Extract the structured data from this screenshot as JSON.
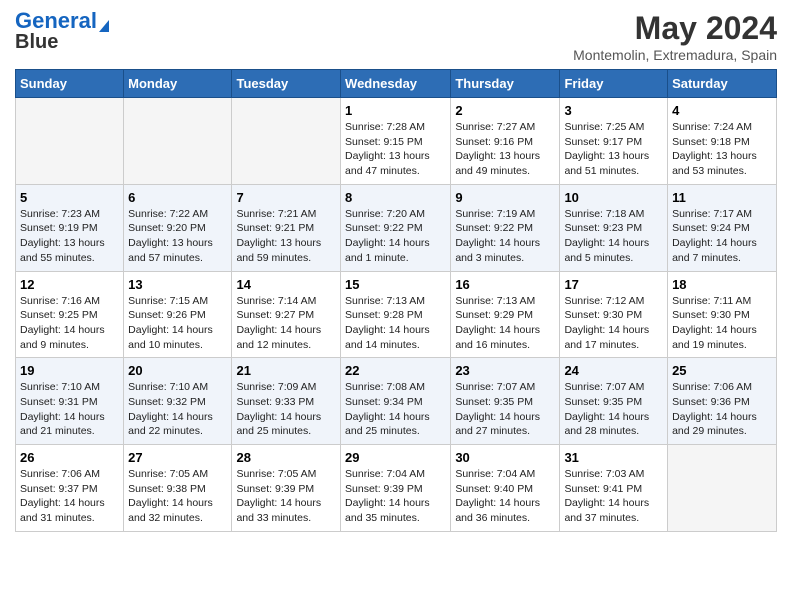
{
  "logo": {
    "part1": "General",
    "part2": "Blue"
  },
  "title": "May 2024",
  "subtitle": "Montemolin, Extremadura, Spain",
  "days_of_week": [
    "Sunday",
    "Monday",
    "Tuesday",
    "Wednesday",
    "Thursday",
    "Friday",
    "Saturday"
  ],
  "weeks": [
    [
      {
        "num": "",
        "sunrise": "",
        "sunset": "",
        "daylight": ""
      },
      {
        "num": "",
        "sunrise": "",
        "sunset": "",
        "daylight": ""
      },
      {
        "num": "",
        "sunrise": "",
        "sunset": "",
        "daylight": ""
      },
      {
        "num": "1",
        "sunrise": "Sunrise: 7:28 AM",
        "sunset": "Sunset: 9:15 PM",
        "daylight": "Daylight: 13 hours and 47 minutes."
      },
      {
        "num": "2",
        "sunrise": "Sunrise: 7:27 AM",
        "sunset": "Sunset: 9:16 PM",
        "daylight": "Daylight: 13 hours and 49 minutes."
      },
      {
        "num": "3",
        "sunrise": "Sunrise: 7:25 AM",
        "sunset": "Sunset: 9:17 PM",
        "daylight": "Daylight: 13 hours and 51 minutes."
      },
      {
        "num": "4",
        "sunrise": "Sunrise: 7:24 AM",
        "sunset": "Sunset: 9:18 PM",
        "daylight": "Daylight: 13 hours and 53 minutes."
      }
    ],
    [
      {
        "num": "5",
        "sunrise": "Sunrise: 7:23 AM",
        "sunset": "Sunset: 9:19 PM",
        "daylight": "Daylight: 13 hours and 55 minutes."
      },
      {
        "num": "6",
        "sunrise": "Sunrise: 7:22 AM",
        "sunset": "Sunset: 9:20 PM",
        "daylight": "Daylight: 13 hours and 57 minutes."
      },
      {
        "num": "7",
        "sunrise": "Sunrise: 7:21 AM",
        "sunset": "Sunset: 9:21 PM",
        "daylight": "Daylight: 13 hours and 59 minutes."
      },
      {
        "num": "8",
        "sunrise": "Sunrise: 7:20 AM",
        "sunset": "Sunset: 9:22 PM",
        "daylight": "Daylight: 14 hours and 1 minute."
      },
      {
        "num": "9",
        "sunrise": "Sunrise: 7:19 AM",
        "sunset": "Sunset: 9:22 PM",
        "daylight": "Daylight: 14 hours and 3 minutes."
      },
      {
        "num": "10",
        "sunrise": "Sunrise: 7:18 AM",
        "sunset": "Sunset: 9:23 PM",
        "daylight": "Daylight: 14 hours and 5 minutes."
      },
      {
        "num": "11",
        "sunrise": "Sunrise: 7:17 AM",
        "sunset": "Sunset: 9:24 PM",
        "daylight": "Daylight: 14 hours and 7 minutes."
      }
    ],
    [
      {
        "num": "12",
        "sunrise": "Sunrise: 7:16 AM",
        "sunset": "Sunset: 9:25 PM",
        "daylight": "Daylight: 14 hours and 9 minutes."
      },
      {
        "num": "13",
        "sunrise": "Sunrise: 7:15 AM",
        "sunset": "Sunset: 9:26 PM",
        "daylight": "Daylight: 14 hours and 10 minutes."
      },
      {
        "num": "14",
        "sunrise": "Sunrise: 7:14 AM",
        "sunset": "Sunset: 9:27 PM",
        "daylight": "Daylight: 14 hours and 12 minutes."
      },
      {
        "num": "15",
        "sunrise": "Sunrise: 7:13 AM",
        "sunset": "Sunset: 9:28 PM",
        "daylight": "Daylight: 14 hours and 14 minutes."
      },
      {
        "num": "16",
        "sunrise": "Sunrise: 7:13 AM",
        "sunset": "Sunset: 9:29 PM",
        "daylight": "Daylight: 14 hours and 16 minutes."
      },
      {
        "num": "17",
        "sunrise": "Sunrise: 7:12 AM",
        "sunset": "Sunset: 9:30 PM",
        "daylight": "Daylight: 14 hours and 17 minutes."
      },
      {
        "num": "18",
        "sunrise": "Sunrise: 7:11 AM",
        "sunset": "Sunset: 9:30 PM",
        "daylight": "Daylight: 14 hours and 19 minutes."
      }
    ],
    [
      {
        "num": "19",
        "sunrise": "Sunrise: 7:10 AM",
        "sunset": "Sunset: 9:31 PM",
        "daylight": "Daylight: 14 hours and 21 minutes."
      },
      {
        "num": "20",
        "sunrise": "Sunrise: 7:10 AM",
        "sunset": "Sunset: 9:32 PM",
        "daylight": "Daylight: 14 hours and 22 minutes."
      },
      {
        "num": "21",
        "sunrise": "Sunrise: 7:09 AM",
        "sunset": "Sunset: 9:33 PM",
        "daylight": "Daylight: 14 hours and 25 minutes."
      },
      {
        "num": "22",
        "sunrise": "Sunrise: 7:08 AM",
        "sunset": "Sunset: 9:34 PM",
        "daylight": "Daylight: 14 hours and 25 minutes."
      },
      {
        "num": "23",
        "sunrise": "Sunrise: 7:07 AM",
        "sunset": "Sunset: 9:35 PM",
        "daylight": "Daylight: 14 hours and 27 minutes."
      },
      {
        "num": "24",
        "sunrise": "Sunrise: 7:07 AM",
        "sunset": "Sunset: 9:35 PM",
        "daylight": "Daylight: 14 hours and 28 minutes."
      },
      {
        "num": "25",
        "sunrise": "Sunrise: 7:06 AM",
        "sunset": "Sunset: 9:36 PM",
        "daylight": "Daylight: 14 hours and 29 minutes."
      }
    ],
    [
      {
        "num": "26",
        "sunrise": "Sunrise: 7:06 AM",
        "sunset": "Sunset: 9:37 PM",
        "daylight": "Daylight: 14 hours and 31 minutes."
      },
      {
        "num": "27",
        "sunrise": "Sunrise: 7:05 AM",
        "sunset": "Sunset: 9:38 PM",
        "daylight": "Daylight: 14 hours and 32 minutes."
      },
      {
        "num": "28",
        "sunrise": "Sunrise: 7:05 AM",
        "sunset": "Sunset: 9:39 PM",
        "daylight": "Daylight: 14 hours and 33 minutes."
      },
      {
        "num": "29",
        "sunrise": "Sunrise: 7:04 AM",
        "sunset": "Sunset: 9:39 PM",
        "daylight": "Daylight: 14 hours and 35 minutes."
      },
      {
        "num": "30",
        "sunrise": "Sunrise: 7:04 AM",
        "sunset": "Sunset: 9:40 PM",
        "daylight": "Daylight: 14 hours and 36 minutes."
      },
      {
        "num": "31",
        "sunrise": "Sunrise: 7:03 AM",
        "sunset": "Sunset: 9:41 PM",
        "daylight": "Daylight: 14 hours and 37 minutes."
      },
      {
        "num": "",
        "sunrise": "",
        "sunset": "",
        "daylight": ""
      }
    ]
  ]
}
